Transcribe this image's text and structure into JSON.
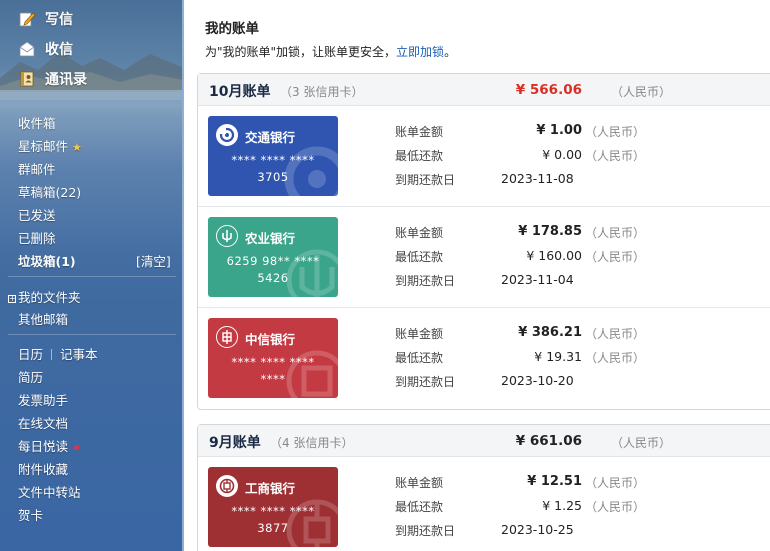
{
  "sidebar": {
    "write_label": "写信",
    "receive_label": "收信",
    "contacts_label": "通讯录",
    "folders": {
      "inbox": "收件箱",
      "starred": "星标邮件",
      "group": "群邮件",
      "drafts": "草稿箱(22)",
      "sent": "已发送",
      "deleted": "已删除",
      "trash": "垃圾箱(1)",
      "trash_clear": "[清空]"
    },
    "my_folders": "我的文件夹",
    "other_mailboxes": "其他邮箱",
    "calendar": "日历",
    "notebook": "记事本",
    "resume": "简历",
    "invoice_assistant": "发票助手",
    "online_docs": "在线文档",
    "daily_reading": "每日悦读",
    "attachments": "附件收藏",
    "file_transfer": "文件中转站",
    "greeting_cards": "贺卡"
  },
  "page": {
    "title": "我的账单",
    "subtitle_prefix": "为\"我的账单\"加锁，让账单更安全，",
    "subtitle_link": "立即加锁",
    "subtitle_suffix": "。"
  },
  "labels": {
    "bill_amount": "账单金额",
    "min_payment": "最低还款",
    "due_date": "到期还款日",
    "currency": "（人民币）"
  },
  "months": [
    {
      "title": "10月账单",
      "count": "（3 张信用卡）",
      "total": "¥ 566.06",
      "total_color": "#d93025",
      "cards": [
        {
          "bank": "交通银行",
          "num1": "**** **** ****",
          "num2": "3705",
          "color": "#2f55b0",
          "bill": "¥ 1.00",
          "min": "¥ 0.00",
          "due": "2023-11-08"
        },
        {
          "bank": "农业银行",
          "num1": "6259 98** ****",
          "num2": "5426",
          "color": "#3aa58a",
          "bill": "¥ 178.85",
          "min": "¥ 160.00",
          "due": "2023-11-04"
        },
        {
          "bank": "中信银行",
          "num1": "**** **** ****",
          "num2": "****",
          "color": "#c43a42",
          "bill": "¥ 386.21",
          "min": "¥ 19.31",
          "due": "2023-10-20"
        }
      ]
    },
    {
      "title": "9月账单",
      "count": "（4 张信用卡）",
      "total": "¥ 661.06",
      "total_color": "#222222",
      "cards": [
        {
          "bank": "工商银行",
          "num1": "**** **** ****",
          "num2": "3877",
          "color": "#9e3034",
          "bill": "¥ 12.51",
          "min": "¥ 1.25",
          "due": "2023-10-25"
        }
      ]
    }
  ]
}
